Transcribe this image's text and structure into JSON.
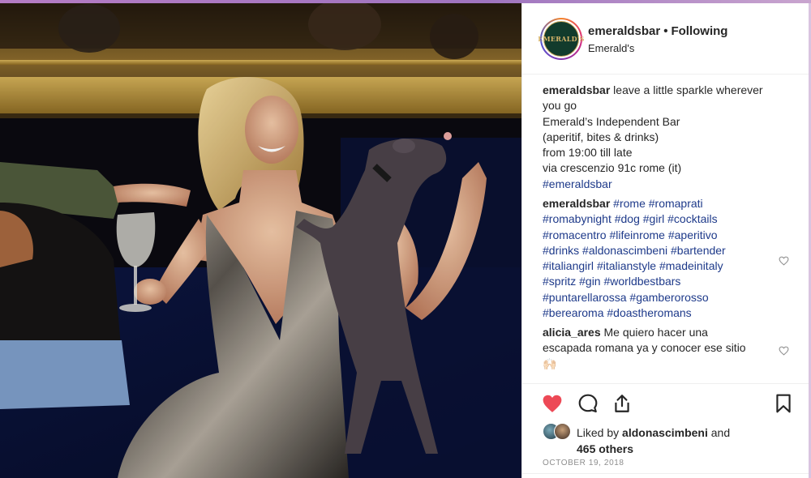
{
  "post": {
    "username": "emeraldsbar",
    "follow_status": "Following",
    "separator": "•",
    "location": "Emerald's",
    "avatar_text": "EMERALD'S"
  },
  "caption": {
    "user": "emeraldsbar",
    "lines": [
      "leave a little sparkle wherever",
      "you go",
      "Emerald’s Independent Bar",
      "(aperitif, bites & drinks)",
      "from 19:00 till late",
      "via crescenzio 91c rome (it)"
    ],
    "hashtag": "#emeraldsbar"
  },
  "hashtag_comment": {
    "user": "emeraldsbar",
    "lines": [
      [
        "#rome",
        "#romaprati"
      ],
      [
        "#romabynight",
        "#dog",
        "#girl",
        "#cocktails"
      ],
      [
        "#romacentro",
        "#lifeinrome",
        "#aperitivo"
      ],
      [
        "#drinks",
        "#aldonascimbeni",
        "#bartender"
      ],
      [
        "#italiangirl",
        "#italianstyle",
        "#madeinitaly"
      ],
      [
        "#spritz",
        "#gin",
        "#worldbestbars"
      ],
      [
        "#puntarellarossa",
        "#gamberorosso"
      ],
      [
        "#berearoma",
        "#doastheromans"
      ]
    ]
  },
  "user_comment": {
    "user": "alicia_ares",
    "line1": "Me quiero hacer una",
    "line2": "escapada romana ya y conocer ese sitio",
    "emoji": "🙌🏻"
  },
  "likes": {
    "prefix": "Liked by",
    "liker": "aldonascimbeni",
    "joiner": "and",
    "others": "465 others"
  },
  "date": "OCTOBER 19, 2018",
  "colors": {
    "like_red": "#ed4956",
    "hashtag_blue": "#1e3a8a",
    "text": "#262626",
    "muted": "#8e8e8e"
  },
  "icons": [
    "heart-icon",
    "comment-icon",
    "share-icon",
    "bookmark-icon"
  ]
}
